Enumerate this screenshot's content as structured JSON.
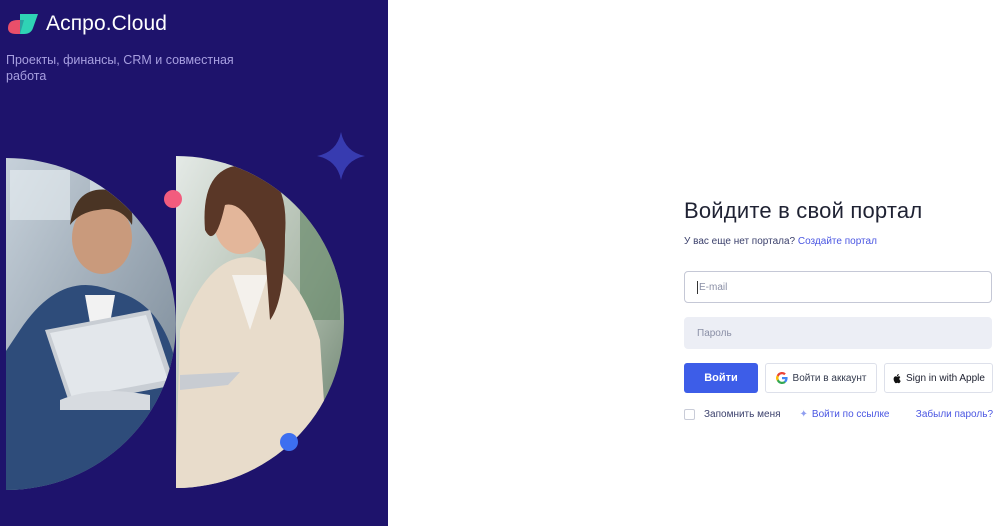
{
  "brand": {
    "name": "Аспро.Cloud",
    "tagline": "Проекты, финансы, CRM и совместная работа",
    "logo_colors": [
      "#e94f6a",
      "#2fd3b5"
    ]
  },
  "hero": {
    "icons": [
      "star-sparkle-icon",
      "pink-dot-icon",
      "blue-dot-icon"
    ],
    "background_color": "#1e136c"
  },
  "login": {
    "title": "Войдите в свой портал",
    "no_portal_text": "У вас еще нет портала?",
    "create_portal_link": "Создайте портал",
    "email_placeholder": "E-mail",
    "password_placeholder": "Пароль",
    "submit_label": "Войти",
    "google_label": "Войти в аккаунт",
    "apple_label": "Sign in with Apple",
    "remember_label": "Запомнить меня",
    "magic_link_label": "Войти по ссылке",
    "forgot_label": "Забыли пароль?",
    "accent_color": "#3d5de8"
  }
}
